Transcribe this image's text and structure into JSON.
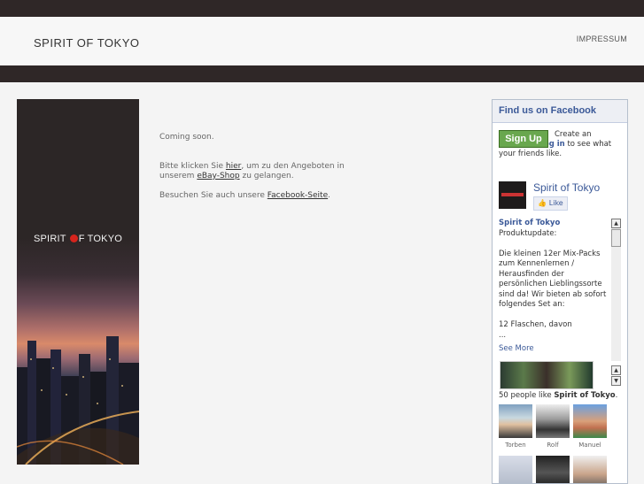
{
  "header": {
    "brand": "SPIRIT OF TOKYO",
    "impressum": "IMPRESSUM"
  },
  "banner": {
    "title_part1": "SPIRIT",
    "title_part2": "F TOKYO"
  },
  "content": {
    "coming_soon": "Coming soon.",
    "p2_prefix": "Bitte klicken Sie",
    "p2_link1": "hier",
    "p2_mid": ", um zu den Angeboten in unserem",
    "p2_link2": "eBay-Shop",
    "p2_suffix": "zu gelangen.",
    "p3_prefix": "Besuchen Sie auch unsere",
    "p3_link": "Facebook-Seite",
    "p3_suffix": "."
  },
  "facebook": {
    "header": "Find us on Facebook",
    "signup": "Sign Up",
    "create_text": "Create an account or",
    "login": "log in",
    "see_text": "to see what your friends like.",
    "page_name": "Spirit of Tokyo",
    "like_label": "Like",
    "post_author": "Spirit of Tokyo",
    "post_line1": "Produktupdate:",
    "post_body": "Die kleinen 12er Mix-Packs zum Kennenlernen / Herausfinden der persönlichen Lieblingssorte sind da! Wir bieten ab sofort folgendes Set an:",
    "post_line_last": "12 Flaschen, davon",
    "ellipsis": "...",
    "see_more": "See More",
    "fans_prefix": "50 people like",
    "fans_page": "Spirit of Tokyo",
    "fans_suffix": ".",
    "fans": [
      {
        "name": "Torben"
      },
      {
        "name": "Rolf"
      },
      {
        "name": "Manuel"
      }
    ]
  }
}
